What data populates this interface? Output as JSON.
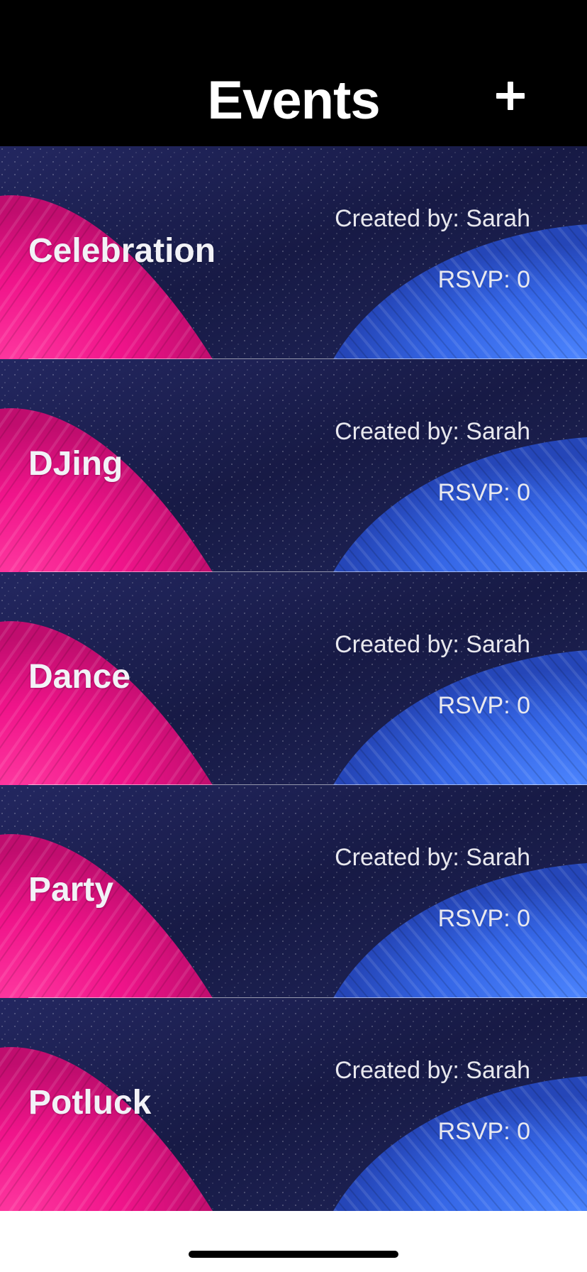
{
  "header": {
    "title": "Events",
    "add_icon": "plus-icon"
  },
  "events": [
    {
      "name": "Celebration",
      "created_by": "Created by: Sarah",
      "rsvp": "RSVP: 0"
    },
    {
      "name": "DJing",
      "created_by": "Created by: Sarah",
      "rsvp": "RSVP: 0"
    },
    {
      "name": "Dance",
      "created_by": "Created by: Sarah",
      "rsvp": "RSVP: 0"
    },
    {
      "name": "Party",
      "created_by": "Created by: Sarah",
      "rsvp": "RSVP: 0"
    },
    {
      "name": "Potluck",
      "created_by": "Created by: Sarah",
      "rsvp": "RSVP: 0"
    }
  ],
  "colors": {
    "header_background": "#000000",
    "background_navy": "#1c1f4e",
    "accent_pink": "#ff1a8c",
    "accent_blue": "#3a6cf0"
  }
}
